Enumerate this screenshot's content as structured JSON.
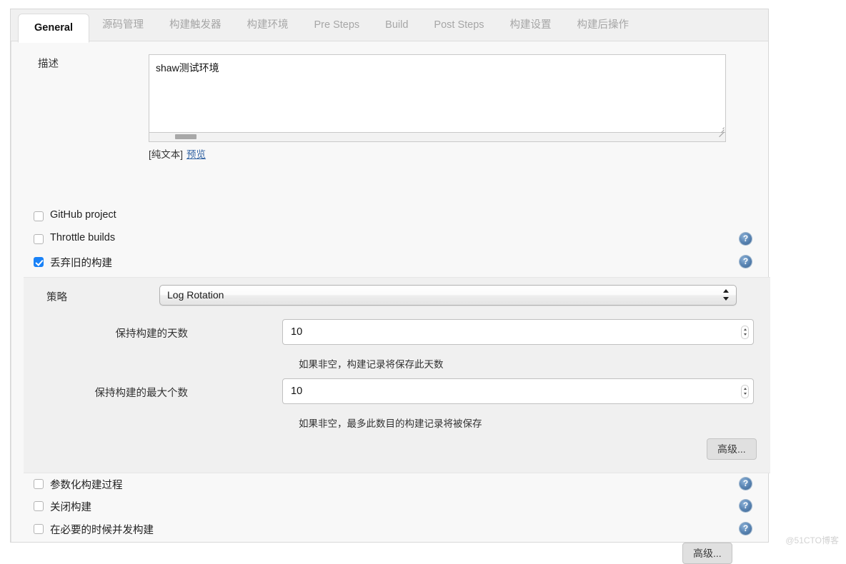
{
  "tabs": [
    {
      "label": "General",
      "active": true
    },
    {
      "label": "源码管理",
      "active": false
    },
    {
      "label": "构建触发器",
      "active": false
    },
    {
      "label": "构建环境",
      "active": false
    },
    {
      "label": "Pre Steps",
      "active": false
    },
    {
      "label": "Build",
      "active": false
    },
    {
      "label": "Post Steps",
      "active": false
    },
    {
      "label": "构建设置",
      "active": false
    },
    {
      "label": "构建后操作",
      "active": false
    }
  ],
  "description": {
    "label": "描述",
    "value": "shaw测试环境",
    "placeholder": "",
    "plain_text_note": "[纯文本]",
    "preview_link": "预览"
  },
  "checkboxes_top": [
    {
      "label": "GitHub project",
      "checked": false,
      "help": false
    },
    {
      "label": "Throttle builds",
      "checked": false,
      "help": true
    },
    {
      "label": "丢弃旧的构建",
      "checked": true,
      "help": true
    }
  ],
  "log_rotation": {
    "strategy_label": "策略",
    "strategy_value": "Log Rotation",
    "strategy_options": [
      "Log Rotation"
    ],
    "days_label": "保持构建的天数",
    "days_value": "10",
    "days_hint": "如果非空，构建记录将保存此天数",
    "max_label": "保持构建的最大个数",
    "max_value": "10",
    "max_hint": "如果非空，最多此数目的构建记录将被保存",
    "advanced_label": "高级..."
  },
  "checkboxes_bottom": [
    {
      "label": "参数化构建过程",
      "checked": false,
      "help": true
    },
    {
      "label": "关闭构建",
      "checked": false,
      "help": true
    },
    {
      "label": "在必要的时候并发构建",
      "checked": false,
      "help": true
    }
  ],
  "footer": {
    "advanced_label": "高级..."
  },
  "watermark": "@51CTO博客",
  "colors": {
    "accent_checkbox": "#1a82f7",
    "link": "#3465a4",
    "help_icon": "#5b86b5",
    "panel_bg": "#f0f0f0",
    "body_bg": "#f8f8f8"
  }
}
